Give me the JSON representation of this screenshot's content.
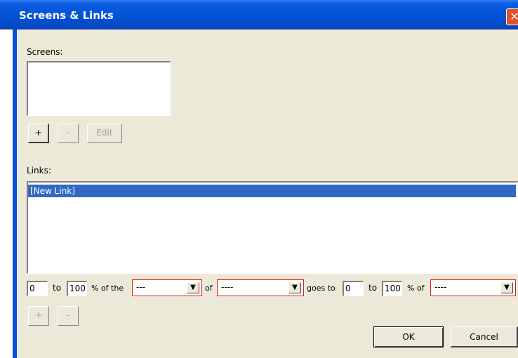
{
  "window": {
    "title": "Screens & Links",
    "close_glyph": "✕"
  },
  "screens": {
    "label": "Screens:",
    "items": []
  },
  "screen_buttons": {
    "add": "+",
    "remove": "-",
    "edit": "Edit"
  },
  "links": {
    "label": "Links:",
    "items": [
      "[New Link]"
    ],
    "selected_index": 0
  },
  "rule": {
    "from_start": "0",
    "to1": "to",
    "from_end": "100",
    "pct_of_the": "% of the",
    "combo1": "---",
    "of": "of",
    "combo2": "----",
    "goes_to": "goes to",
    "to_start": "0",
    "to2": "to",
    "to_end": "100",
    "pct_of": "% of",
    "combo3": "----"
  },
  "link_buttons": {
    "add": "+",
    "remove": "-"
  },
  "dialog_buttons": {
    "ok": "OK",
    "cancel": "Cancel"
  },
  "colors": {
    "title_bar": "#0452d6",
    "selection": "#316ac5",
    "invalid_border": "#e02020",
    "face": "#ece9d8"
  }
}
